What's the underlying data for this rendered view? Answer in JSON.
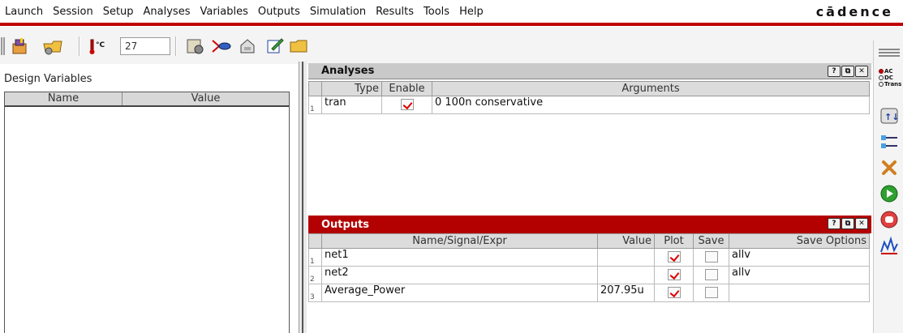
{
  "menu": {
    "items": [
      "Launch",
      "Session",
      "Setup",
      "Analyses",
      "Variables",
      "Outputs",
      "Simulation",
      "Results",
      "Tools",
      "Help"
    ],
    "brand": "cādence"
  },
  "toolbar": {
    "temperature_value": "27",
    "temperature_unit": "°C",
    "icons": [
      "new-session-icon",
      "open-icon",
      "thermometer-icon",
      "simulator-icon",
      "probe-icon",
      "state-icon",
      "edit-icon",
      "folder-icon"
    ]
  },
  "design_variables": {
    "title": "Design Variables",
    "columns": [
      "Name",
      "Value"
    ],
    "rows": []
  },
  "analyses": {
    "title": "Analyses",
    "columns": [
      "Type",
      "Enable",
      "Arguments"
    ],
    "rows": [
      {
        "num": "1",
        "type": "tran",
        "enabled": true,
        "arguments": "0 100n conservative"
      }
    ]
  },
  "outputs": {
    "title": "Outputs",
    "columns": [
      "Name/Signal/Expr",
      "Value",
      "Plot",
      "Save",
      "Save Options"
    ],
    "rows": [
      {
        "num": "1",
        "name": "net1",
        "value": "",
        "plot": true,
        "save": false,
        "save_options": "allv"
      },
      {
        "num": "2",
        "name": "net2",
        "value": "",
        "plot": true,
        "save": false,
        "save_options": "allv"
      },
      {
        "num": "3",
        "name": "Average_Power",
        "value": "207.95u",
        "plot": true,
        "save": false,
        "save_options": ""
      }
    ]
  },
  "window_buttons": [
    "?",
    "⧉",
    "✕"
  ],
  "right_toolbar": {
    "analysis_radios": [
      "AC",
      "DC",
      "Trans"
    ],
    "selected_radio": "AC"
  },
  "colors": {
    "accent_red": "#c00000",
    "outputs_title_bg": "#b30000",
    "analyses_title_bg": "#c9c9c9"
  }
}
